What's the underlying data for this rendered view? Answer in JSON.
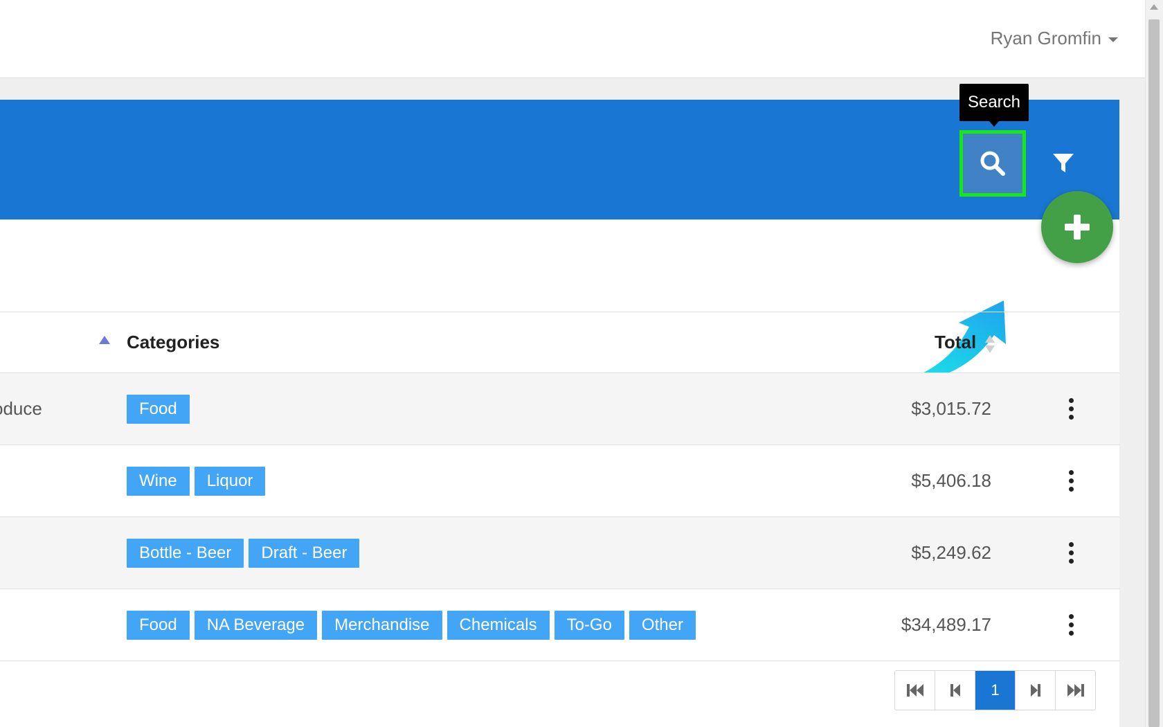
{
  "user": {
    "name": "Ryan Gromfin"
  },
  "header": {
    "tooltip": "Search",
    "search_icon": "search-icon",
    "filter_icon": "filter-icon",
    "add_icon": "plus-icon"
  },
  "colors": {
    "header": "#1976d2",
    "tag": "#42a5f5",
    "fab": "#43a047",
    "highlight": "#19e619"
  },
  "table": {
    "columns": {
      "categories": "Categories",
      "total": "Total"
    },
    "rows": [
      {
        "name": "oduce",
        "tags": [
          "Food"
        ],
        "total": "$3,015.72"
      },
      {
        "name": "",
        "tags": [
          "Wine",
          "Liquor"
        ],
        "total": "$5,406.18"
      },
      {
        "name": "",
        "tags": [
          "Bottle - Beer",
          "Draft - Beer"
        ],
        "total": "$5,249.62"
      },
      {
        "name": "",
        "tags": [
          "Food",
          "NA Beverage",
          "Merchandise",
          "Chemicals",
          "To-Go",
          "Other"
        ],
        "total": "$34,489.17"
      }
    ]
  },
  "pagination": {
    "current_page": "1"
  }
}
